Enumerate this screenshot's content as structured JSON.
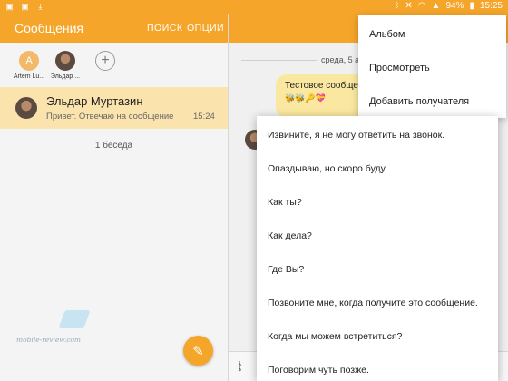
{
  "status_bar": {
    "battery": "94%",
    "time": "15:25"
  },
  "app_bar": {
    "title": "Сообщения",
    "search_label": "ПОИСК",
    "options_label": "ОПЦИИ"
  },
  "favorites": [
    {
      "initial": "A",
      "name": "Artem Lu..."
    },
    {
      "name": "Эльдар ..."
    }
  ],
  "conversation": {
    "name": "Эльдар Муртазин",
    "snippet": "Привет. Отвечаю на сообщение",
    "time": "15:24"
  },
  "conversation_count": "1 беседа",
  "watermark": "mobile-review.com",
  "thread": {
    "date": "среда, 5 а",
    "bubble_text": "Тестовое сообще",
    "bubble_emoji": "🐝🐝🔑💝"
  },
  "menu": {
    "items": [
      "Альбом",
      "Просмотреть",
      "Добавить получателя"
    ]
  },
  "quick_replies": [
    "Извините, я не могу ответить на звонок.",
    "Опаздываю, но скоро буду.",
    "Как ты?",
    "Как дела?",
    "Где Вы?",
    "Позвоните мне, когда получите это сообщение.",
    "Когда мы можем встретиться?",
    "Поговорим чуть позже."
  ],
  "colors": {
    "accent": "#f5a52a",
    "selected_row": "#fbe3ae",
    "bubble": "#fbe8a0"
  },
  "icons": [
    "image-icon",
    "download-icon",
    "bluetooth-icon",
    "mute-icon",
    "wifi-icon",
    "signal-icon",
    "battery-icon",
    "plus-icon",
    "compose-icon",
    "paperclip-icon"
  ]
}
